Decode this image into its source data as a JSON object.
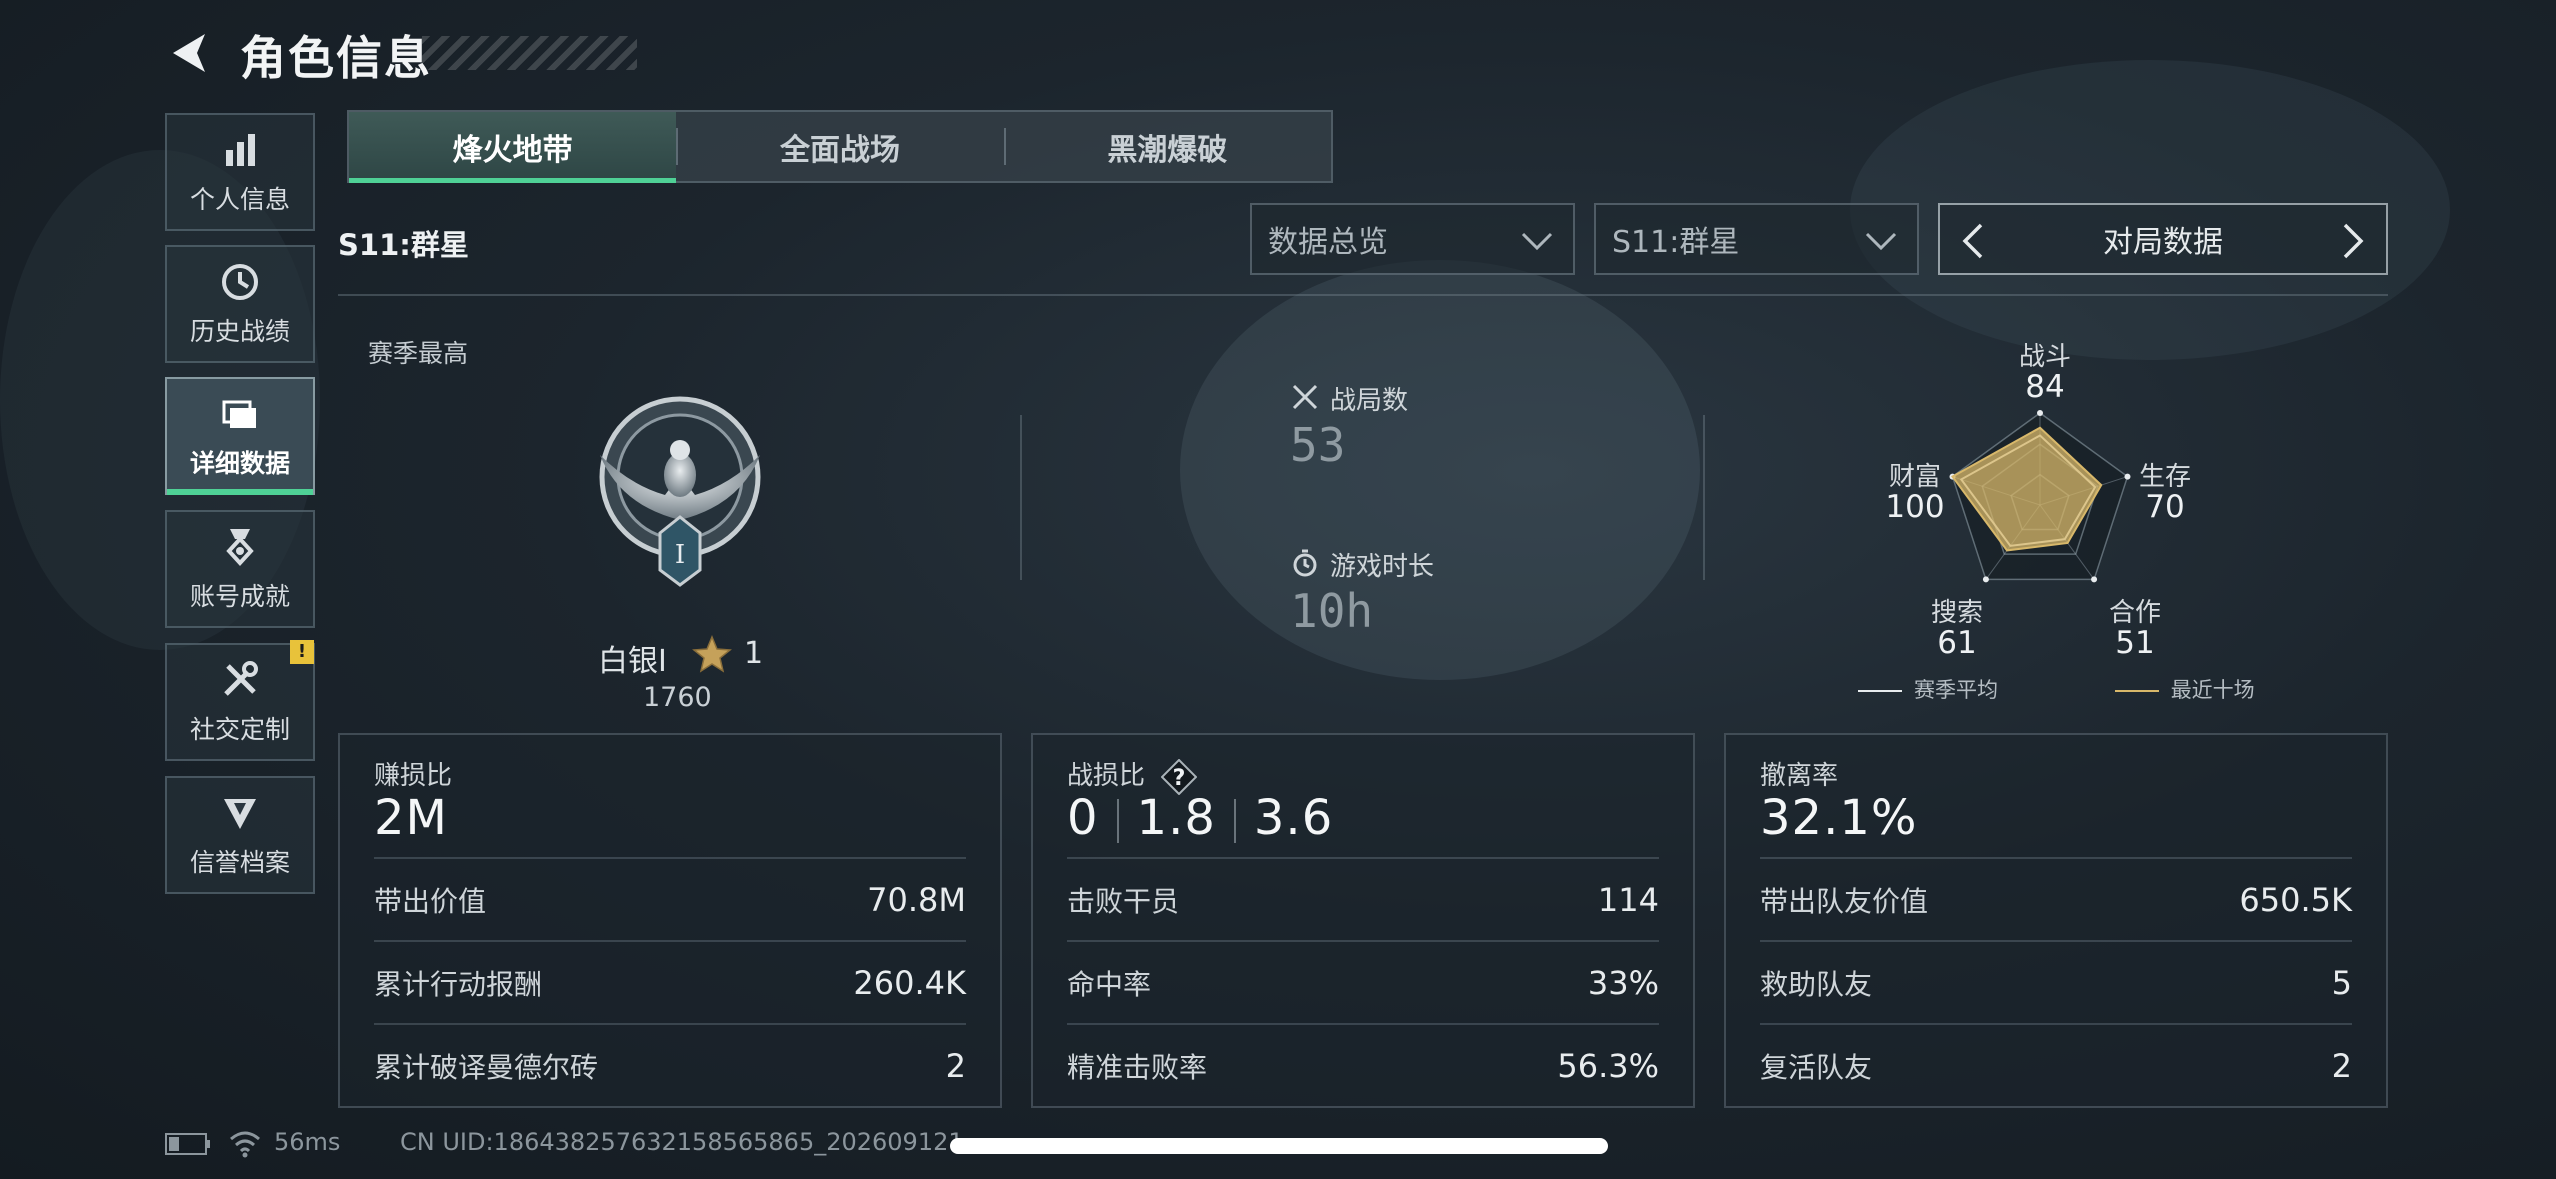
{
  "header": {
    "title": "角色信息"
  },
  "sidebar": {
    "items": [
      {
        "label": "个人信息",
        "icon": "bar-chart-icon",
        "active": false
      },
      {
        "label": "历史战绩",
        "icon": "clock-icon",
        "active": false
      },
      {
        "label": "详细数据",
        "icon": "folder-icon",
        "active": true
      },
      {
        "label": "账号成就",
        "icon": "medal-icon",
        "active": false
      },
      {
        "label": "社交定制",
        "icon": "tools-icon",
        "active": false
      },
      {
        "label": "信誉档案",
        "icon": "shield-icon",
        "active": false
      }
    ],
    "alert_badge": "!"
  },
  "tabs": [
    {
      "label": "烽火地带",
      "active": true
    },
    {
      "label": "全面战场",
      "active": false
    },
    {
      "label": "黑潮爆破",
      "active": false
    }
  ],
  "season_label": "S11:群星",
  "dropdowns": [
    {
      "value": "数据总览"
    },
    {
      "value": "S11:群星"
    }
  ],
  "pager": {
    "label": "对局数据"
  },
  "best": {
    "label": "赛季最高",
    "rank": "白银I",
    "stars": "1",
    "score": "1760",
    "medal_numeral": "I"
  },
  "stats": {
    "matches_label": "战局数",
    "matches_value": "53",
    "time_label": "游戏时长",
    "time_value": "10h"
  },
  "radar": {
    "axes": [
      {
        "name": "战斗",
        "value": "84"
      },
      {
        "name": "生存",
        "value": "70"
      },
      {
        "name": "合作",
        "value": "51"
      },
      {
        "name": "搜索",
        "value": "61"
      },
      {
        "name": "财富",
        "value": "100"
      }
    ],
    "legend_avg": "赛季平均",
    "legend_recent": "最近十场",
    "color_avg": "#e8ecee",
    "color_recent": "#d8b86a"
  },
  "cards": [
    {
      "title": "赚损比",
      "value": "2M",
      "rows": [
        {
          "k": "带出价值",
          "v": "70.8M"
        },
        {
          "k": "累计行动报酬",
          "v": "260.4K"
        },
        {
          "k": "累计破译曼德尔砖",
          "v": "2"
        }
      ]
    },
    {
      "title": "战损比",
      "values": [
        "0",
        "1.8",
        "3.6"
      ],
      "rows": [
        {
          "k": "击败干员",
          "v": "114"
        },
        {
          "k": "命中率",
          "v": "33%"
        },
        {
          "k": "精准击败率",
          "v": "56.3%"
        }
      ]
    },
    {
      "title": "撤离率",
      "value": "32.1%",
      "rows": [
        {
          "k": "带出队友价值",
          "v": "650.5K"
        },
        {
          "k": "救助队友",
          "v": "5"
        },
        {
          "k": "复活队友",
          "v": "2"
        }
      ]
    }
  ],
  "footer": {
    "ping": "56ms",
    "uid": "CN UID:186438257632158565865_202609121"
  },
  "colors": {
    "accent": "#4fd196",
    "warning": "#e8c23a"
  }
}
